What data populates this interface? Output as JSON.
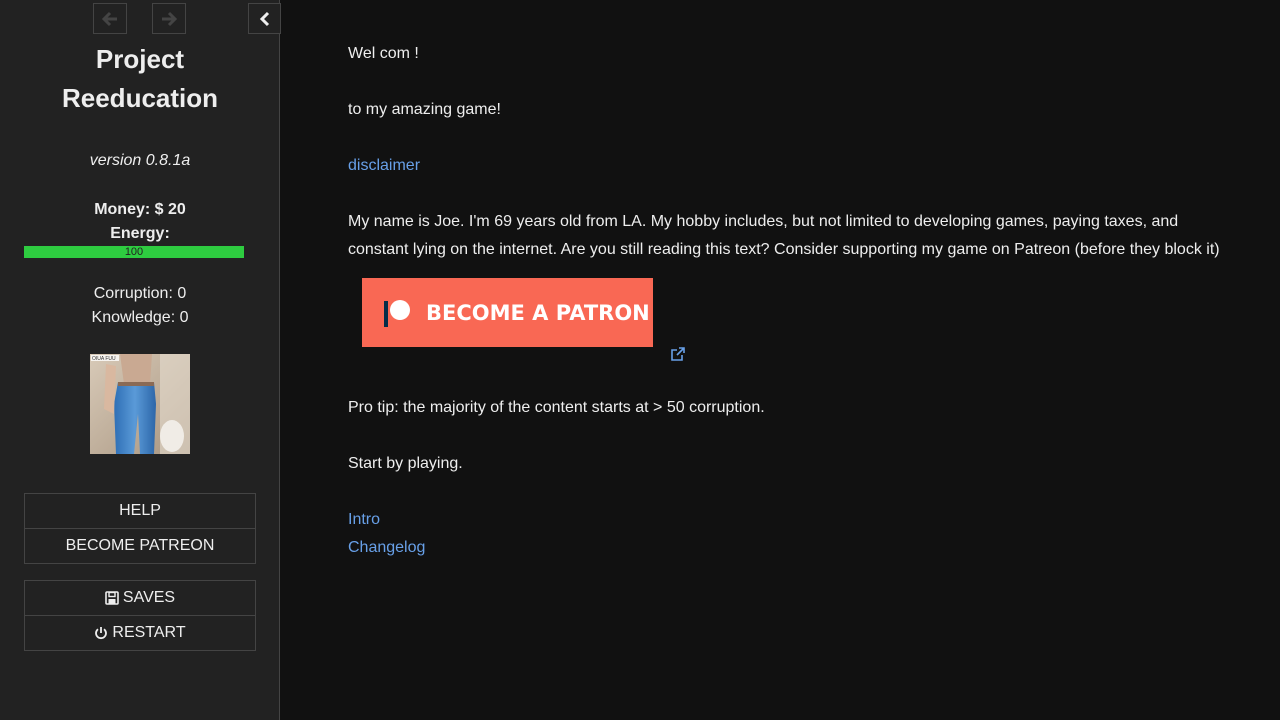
{
  "sidebar": {
    "title_line1": "Project",
    "title_line2": "Reeducation",
    "version": "version 0.8.1a",
    "money": "Money: $ 20",
    "energy_label": "Energy:",
    "energy_value": "100",
    "energy_fraction": 1.0,
    "corruption": "Corruption: 0",
    "knowledge": "Knowledge: 0",
    "portrait_caption": "OIUA FUU",
    "menu_top": [
      {
        "label": "HELP"
      },
      {
        "label": "BECOME PATREON"
      }
    ],
    "menu_bottom": [
      {
        "label": "SAVES",
        "icon": "save-icon"
      },
      {
        "label": "RESTART",
        "icon": "power-icon"
      }
    ]
  },
  "passage": {
    "welcome": "Wel com !",
    "subtitle": "to my amazing game!",
    "disclaimer_link": "disclaimer",
    "intro_text": "My name is Joe. I'm 69 years old from LA. My hobby includes, but not limited to developing games, paying taxes, and constant lying on the internet. Are you still reading this text? Consider supporting my game on Patreon (before they block it)",
    "patron_button": "BECOME A PATRON",
    "pro_tip": "Pro tip: the majority of the content starts at > 50 corruption.",
    "start_text": "Start by playing.",
    "intro_link": "Intro",
    "changelog_link": "Changelog"
  },
  "colors": {
    "sidebar_bg": "#222222",
    "page_bg": "#111111",
    "link": "#68a0e8",
    "energy_bar": "#2ecc40",
    "patreon": "#f96854"
  }
}
